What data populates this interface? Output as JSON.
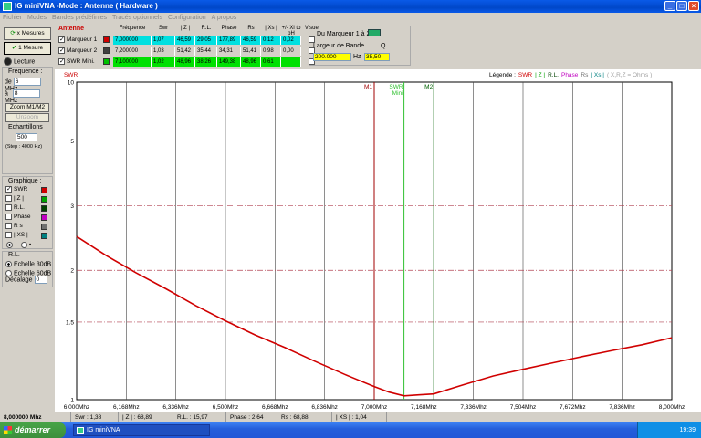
{
  "window": {
    "title": "IG miniVNA -Mode : Antenne ( Hardware )"
  },
  "menu": [
    "Fichier",
    "Modes",
    "Bandes prédéfinies",
    "Tracés optionnels",
    "Configuration",
    "A propos"
  ],
  "left": {
    "btn_mesures": "x Mesures",
    "btn_une_mesure": "1 Mesure",
    "lecture": "Lecture",
    "frequence_label": "Fréquence :",
    "de_label": "de",
    "de_value": "6",
    "a_label": "à",
    "a_value": "8",
    "mhz": "MHz",
    "zoom_btn": "Zoom M1/M2",
    "unzoom_btn": "Unzoom",
    "echantillons_label": "Echantillons",
    "echantillons_value": "500",
    "step_text": "(Step : 4000 Hz)",
    "graphique_label": "Graphique :",
    "graph_items": [
      {
        "label": "SWR",
        "checked": "✓",
        "color": "#d00000"
      },
      {
        "label": "| Z |",
        "checked": "",
        "color": "#00a000"
      },
      {
        "label": "R.L.",
        "checked": "",
        "color": "#004000"
      },
      {
        "label": "Phase",
        "checked": "",
        "color": "#c000c0"
      },
      {
        "label": "R s",
        "checked": "",
        "color": "#707070"
      },
      {
        "label": "| XS |",
        "checked": "",
        "color": "#008080"
      }
    ],
    "rl_label": "R.L.",
    "echelle_30": "Echelle 30dB",
    "echelle_60": "Echelle 60dB",
    "decalage_label": "Décalage",
    "decalage_value": "0"
  },
  "top": {
    "antenne_label": "Antenne",
    "headers": [
      "Fréquence",
      "Swr",
      "| Z |",
      "R.L.",
      "Phase",
      "Rs",
      "| Xs |",
      "+/- Xl to pH",
      "Visuel"
    ],
    "rows": [
      {
        "label": "Marqueur 1",
        "color": "#d00000",
        "bg": "#00e0e0",
        "values": [
          "7,000000",
          "1,07",
          "46,59",
          "29,05",
          "177,89",
          "46,59",
          "0,12",
          "0,02"
        ]
      },
      {
        "label": "Marqueur 2",
        "color": "#404040",
        "bg": "#d4d0c8",
        "values": [
          "7,200000",
          "1,03",
          "51,42",
          "35,44",
          "34,31",
          "51,41",
          "0,98",
          "0,00"
        ]
      },
      {
        "label": "SWR Mini.",
        "color": "#00c000",
        "bg": "#00e000",
        "values": [
          "7,100000",
          "1,02",
          "48,96",
          "38,26",
          "149,38",
          "48,96",
          "0,61",
          ""
        ]
      }
    ],
    "du_marqueur": "Du Marqueur 1 à 2",
    "largeur_label": "Largeur de Bande",
    "q_label": "Q",
    "largeur_value": "200.000",
    "hz": "Hz",
    "q_value": "35,50"
  },
  "plot": {
    "y_title": "SWR",
    "legende_label": "Légende :",
    "legend_items": [
      {
        "text": "SWR",
        "color": "#d00000"
      },
      {
        "text": "| Z |",
        "color": "#00a000"
      },
      {
        "text": "R.L.",
        "color": "#004000"
      },
      {
        "text": "Phase",
        "color": "#c000c0"
      },
      {
        "text": "Rs",
        "color": "#707070"
      },
      {
        "text": "| Xs |",
        "color": "#008080"
      },
      {
        "text": "( X,R,Z = Ohms )",
        "color": "#a0a0a0"
      }
    ],
    "marker_m1": "M1",
    "marker_m2": "M2",
    "marker_swr": "SWR",
    "marker_mini": "Mini"
  },
  "chart_data": {
    "type": "line",
    "title": "",
    "ylabel": "SWR",
    "xlabel": "",
    "x_ticks": [
      "6,000Mhz",
      "6,168Mhz",
      "6,336Mhz",
      "6,500Mhz",
      "6,668Mhz",
      "6,836Mhz",
      "7,000Mhz",
      "7,168Mhz",
      "7,336Mhz",
      "7,504Mhz",
      "7,672Mhz",
      "7,836Mhz",
      "8,000Mhz"
    ],
    "y_ticks": [
      "10",
      "5",
      "3",
      "2",
      "1.5",
      "1"
    ],
    "xlim": [
      6.0,
      8.0
    ],
    "ylim": [
      1,
      10
    ],
    "y_scale": "reflection",
    "grid": true,
    "markers": {
      "M1": 7.0,
      "M2": 7.2,
      "SWR Mini": 7.1
    },
    "series": [
      {
        "color": "#d00000",
        "x": [
          6.0,
          6.1,
          6.2,
          6.3,
          6.4,
          6.5,
          6.6,
          6.7,
          6.8,
          6.9,
          7.0,
          7.05,
          7.1,
          7.15,
          7.2,
          7.3,
          7.4,
          7.5,
          7.6,
          7.7,
          7.8,
          7.9,
          8.0
        ],
        "y": [
          2.45,
          2.18,
          1.97,
          1.8,
          1.64,
          1.51,
          1.4,
          1.31,
          1.22,
          1.14,
          1.07,
          1.04,
          1.02,
          1.025,
          1.03,
          1.08,
          1.13,
          1.17,
          1.21,
          1.25,
          1.29,
          1.33,
          1.38
        ]
      }
    ]
  },
  "status": {
    "freq": "8,000000 Mhz",
    "swr": "Swr : 1,38",
    "z": "| Z | : 68,89",
    "rl": "R.L. : 15,97",
    "phase": "Phase : 2,64",
    "rs": "Rs : 68,88",
    "xs": "| XS | : 1,04"
  },
  "taskbar": {
    "start": "démarrer",
    "task": "IG miniVNA",
    "clock": "19:39"
  }
}
